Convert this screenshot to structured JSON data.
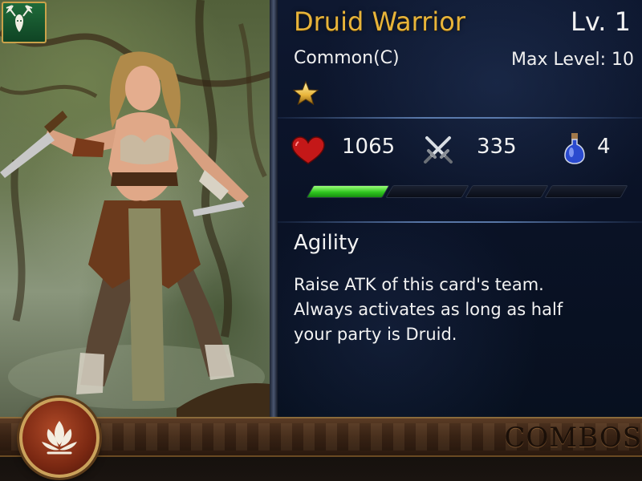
{
  "card": {
    "name": "Druid Warrior",
    "level_label": "Lv. 1",
    "rarity": "Common(C)",
    "max_level_label": "Max Level: 10",
    "stars": 1,
    "faction_emblem": "stag-head-icon"
  },
  "stats": {
    "hp": "1065",
    "atk": "335",
    "cost": "4",
    "hp_icon": "heart-icon",
    "atk_icon": "crossed-swords-icon",
    "cost_icon": "potion-icon"
  },
  "exp": {
    "segments": 4,
    "progress_fraction": 0.25,
    "fill_color": "#2fc51f"
  },
  "skill": {
    "name": "Agility",
    "description": "Raise ATK of this card's team.\nAlways activates as long as half\nyour party is Druid."
  },
  "bottom": {
    "combos_label": "COMBOS",
    "faction_icon": "druid-lotus-icon"
  },
  "colors": {
    "name_gold": "#e8b43a",
    "panel_bg": "#0a1226",
    "faction_green": "#1f6b3a",
    "medallion_red": "#7a2812"
  }
}
